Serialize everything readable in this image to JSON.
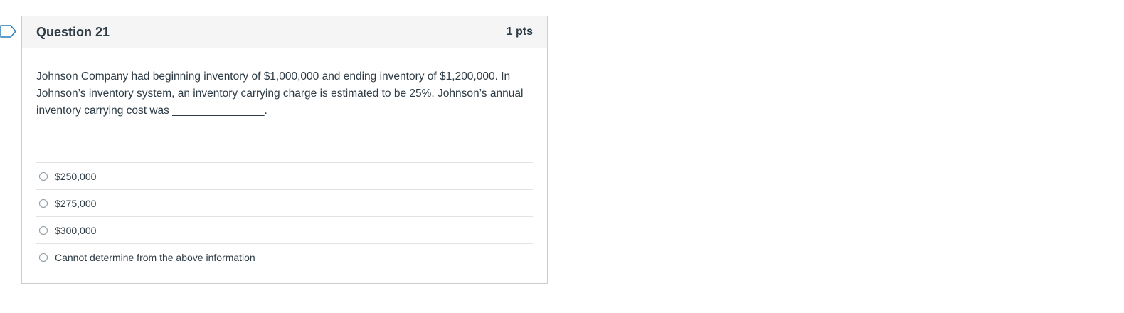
{
  "question": {
    "title": "Question 21",
    "points": "1 pts",
    "text": "Johnson Company had beginning inventory of $1,000,000 and ending inventory of $1,200,000. In Johnson’s inventory system, an inventory carrying charge is estimated to be 25%. Johnson’s annual inventory carrying cost was _______________.",
    "answers": [
      {
        "label": "$250,000"
      },
      {
        "label": "$275,000"
      },
      {
        "label": "$300,000"
      },
      {
        "label": "Cannot determine from the above information"
      }
    ]
  },
  "icons": {
    "flag": "flag-icon",
    "radio": "radio-unchecked-icon"
  },
  "colors": {
    "header_bg": "#f5f5f5",
    "border": "#c7cdd1",
    "text": "#2d3b45",
    "flag_stroke": "#2d7bb6"
  }
}
